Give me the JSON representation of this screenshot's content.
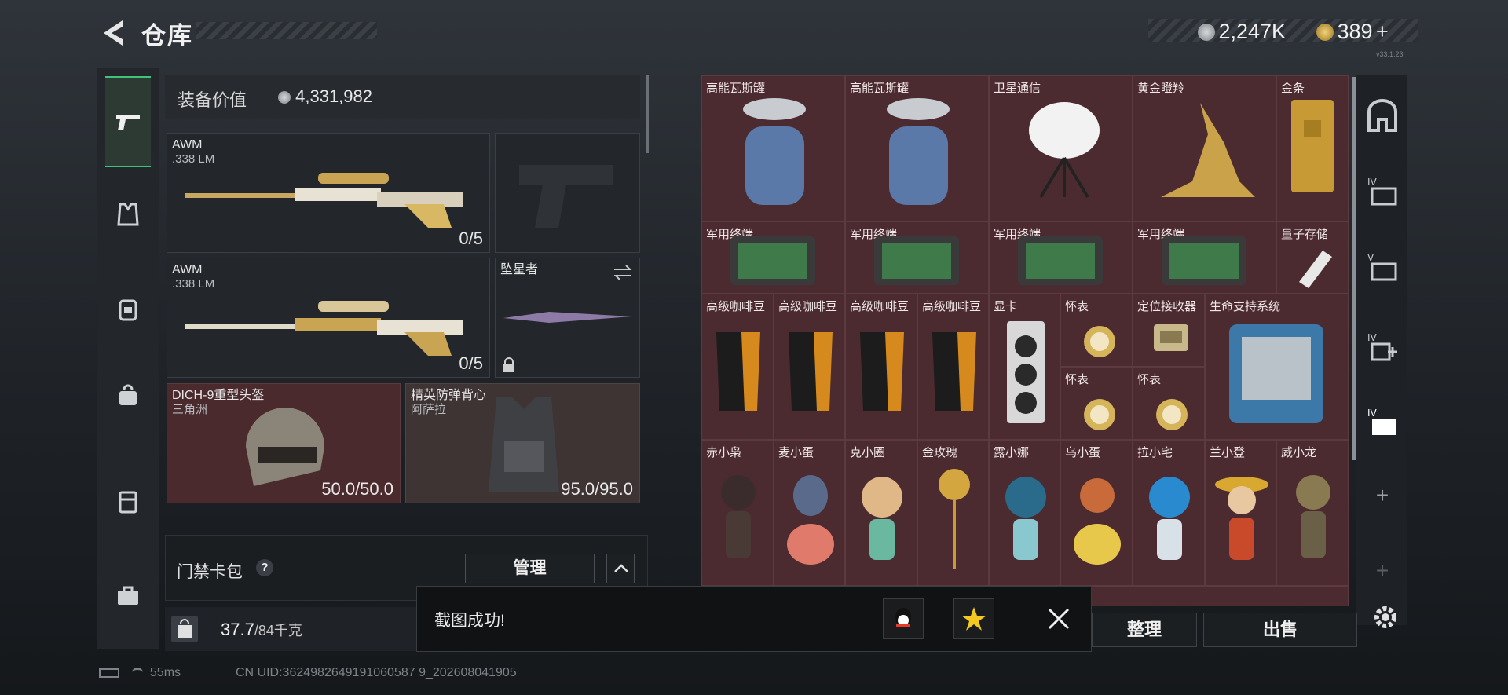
{
  "header": {
    "title": "仓库",
    "currency_a": "2,247K",
    "currency_b": "389",
    "add_label": "+",
    "version": "v33.1.23"
  },
  "nav": {
    "items": [
      "pistol-icon",
      "vest-icon",
      "backpack-icon",
      "bag-icon",
      "case-icon",
      "toolbox-icon"
    ]
  },
  "equipment": {
    "value_label": "装备价值",
    "value": "4,331,982",
    "slots": [
      {
        "name": "AWM",
        "sub": ".338 LM",
        "count": "0/5"
      },
      {
        "name": "",
        "sub": "",
        "count": ""
      },
      {
        "name": "AWM",
        "sub": ".338 LM",
        "count": "0/5"
      },
      {
        "name": "坠星者",
        "sub": "",
        "count": ""
      },
      {
        "name": "DICH-9重型头盔",
        "sub": "三角洲",
        "count": "50.0/50.0"
      },
      {
        "name": "精英防弹背心",
        "sub": "阿萨拉",
        "count": "95.0/95.0"
      }
    ]
  },
  "card_pack": {
    "label": "门禁卡包",
    "help": "?",
    "manage": "管理"
  },
  "weight": {
    "value": "37.7",
    "max": "/84千克"
  },
  "grid": {
    "items": [
      {
        "name": "高能瓦斯罐"
      },
      {
        "name": "高能瓦斯罐"
      },
      {
        "name": "卫星通信"
      },
      {
        "name": "黄金瞪羚"
      },
      {
        "name": "金条"
      },
      {
        "name": "军用终端"
      },
      {
        "name": "军用终端"
      },
      {
        "name": "军用终端"
      },
      {
        "name": "军用终端"
      },
      {
        "name": "量子存储"
      },
      {
        "name": "高级咖啡豆"
      },
      {
        "name": "高级咖啡豆"
      },
      {
        "name": "高级咖啡豆"
      },
      {
        "name": "高级咖啡豆"
      },
      {
        "name": "显卡"
      },
      {
        "name": "怀表"
      },
      {
        "name": "定位接收器"
      },
      {
        "name": "生命支持系统"
      },
      {
        "name": "怀表"
      },
      {
        "name": "怀表"
      },
      {
        "name": "赤小枭"
      },
      {
        "name": "麦小蛋"
      },
      {
        "name": "克小圈"
      },
      {
        "name": "金玫瑰"
      },
      {
        "name": "露小娜"
      },
      {
        "name": "乌小蛋"
      },
      {
        "name": "拉小宅"
      },
      {
        "name": "兰小登"
      },
      {
        "name": "威小龙"
      }
    ]
  },
  "right_nav": {
    "plus": "+"
  },
  "actions": {
    "sort": "整理",
    "sell": "出售"
  },
  "toast": {
    "text": "截图成功!"
  },
  "status": {
    "ping": "55ms",
    "uid": "CN UID:3624982649191060587 9_202608041905"
  }
}
